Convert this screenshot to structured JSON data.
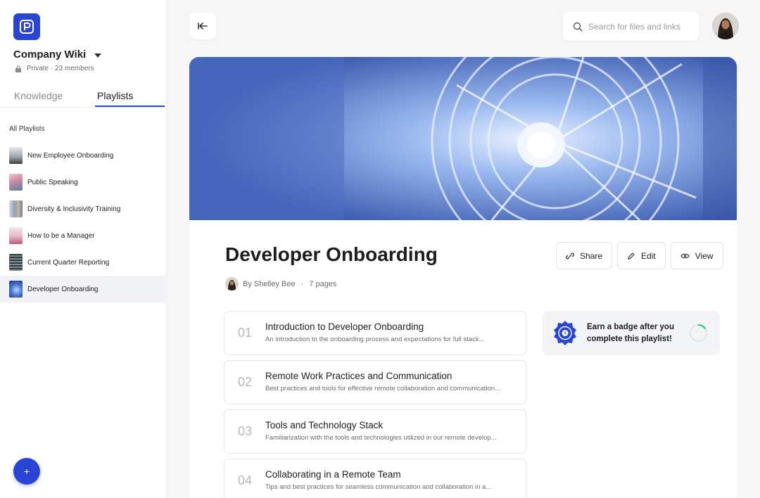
{
  "workspace": {
    "name": "Company Wiki",
    "meta": "Private · 23 members"
  },
  "sidebar": {
    "tabs": [
      {
        "label": "Knowledge",
        "active": false
      },
      {
        "label": "Playlists",
        "active": true
      }
    ],
    "section_label": "All Playlists",
    "playlists": [
      {
        "label": "New Employee Onboarding",
        "active": false
      },
      {
        "label": "Public Speaking",
        "active": false
      },
      {
        "label": "Diversity & Inclusivity Training",
        "active": false
      },
      {
        "label": "How to be a Manager",
        "active": false
      },
      {
        "label": "Current Quarter Reporting",
        "active": false
      },
      {
        "label": "Developer Onboarding",
        "active": true
      }
    ],
    "fab_label": "+"
  },
  "search": {
    "placeholder": "Search for files and links"
  },
  "playlist": {
    "title": "Developer Onboarding",
    "author": "By Shelley Bee",
    "separator": "·",
    "page_count": "7 pages",
    "actions": {
      "share": "Share",
      "edit": "Edit",
      "view": "View"
    },
    "pages": [
      {
        "num": "01",
        "title": "Introduction to Developer Onboarding",
        "desc": "An introduction to the onboarding process and expectations for full stack..."
      },
      {
        "num": "02",
        "title": "Remote Work Practices and Communication",
        "desc": "Best practices and tools for effective remote collaboration and communication..."
      },
      {
        "num": "03",
        "title": "Tools and Technology Stack",
        "desc": "Familiarization with the tools and technologies utilized in our remote develop..."
      },
      {
        "num": "04",
        "title": "Collaborating in a Remote Team",
        "desc": "Tips and best practices for seamless communication and collaboration in a..."
      }
    ],
    "badge": {
      "text": "Earn a badge after you complete this playlist!",
      "progress": 0.15
    }
  },
  "colors": {
    "accent": "#2a44d6",
    "progress": "#3cc47c"
  }
}
